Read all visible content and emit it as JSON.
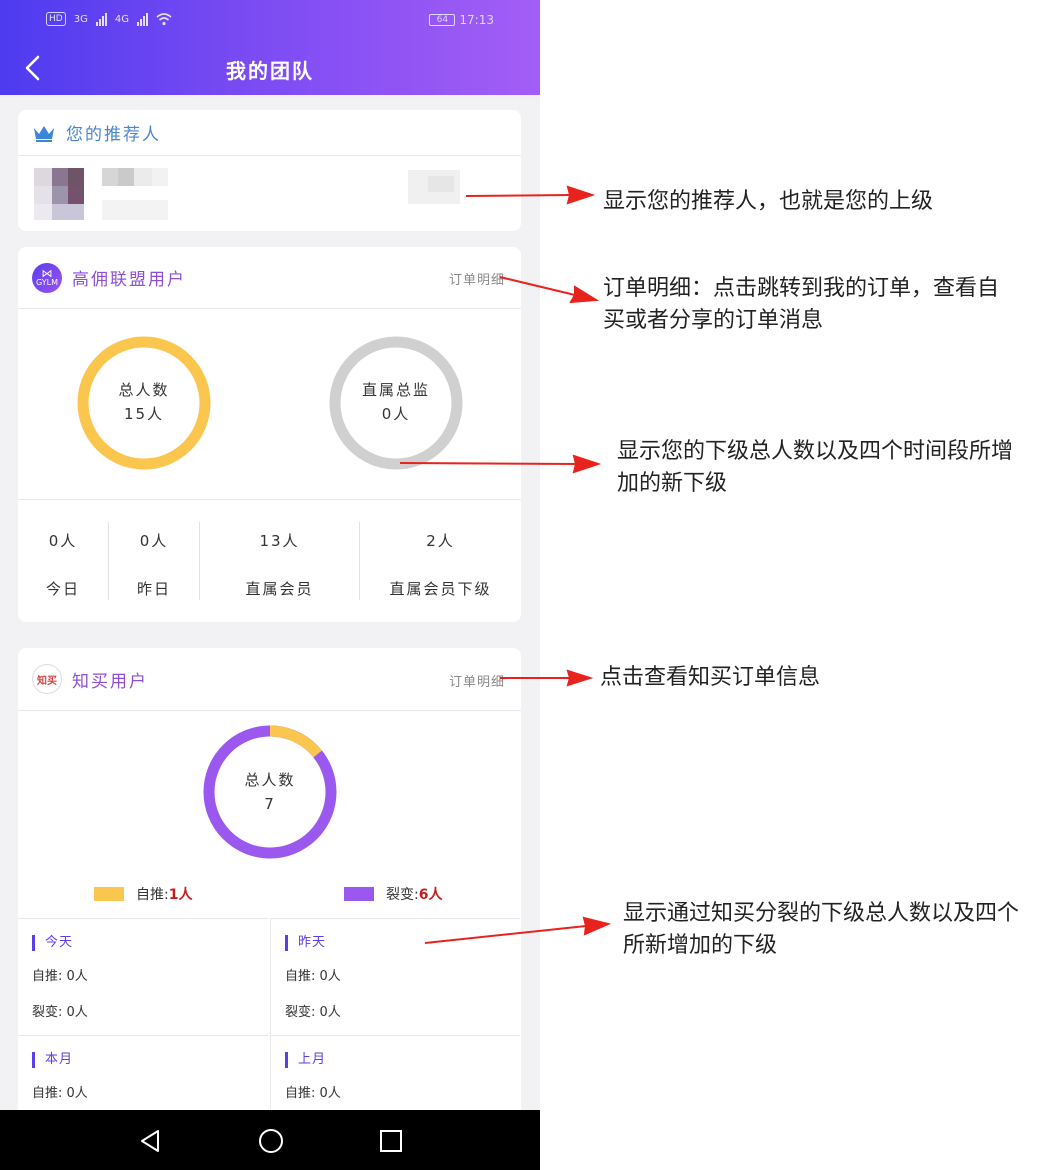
{
  "status_bar": {
    "network_1": "3G",
    "network_2": "4G",
    "battery": "64",
    "time": "17:13",
    "hd": "HD"
  },
  "header": {
    "title": "我的团队"
  },
  "referrer_card": {
    "title": "您的推荐人"
  },
  "gylm_card": {
    "logo_text": "GYLM",
    "title": "高佣联盟用户",
    "detail_link": "订单明细",
    "total_label": "总人数",
    "total_value": "15人",
    "direct_label": "直属总监",
    "direct_value": "0人",
    "stats": [
      {
        "value": "0人",
        "label": "今日"
      },
      {
        "value": "0人",
        "label": "昨日"
      },
      {
        "value": "13人",
        "label": "直属会员"
      },
      {
        "value": "2人",
        "label": "直属会员下级"
      }
    ],
    "colors": {
      "total_ring": "#fbc64e",
      "direct_ring": "#d0d0d0"
    }
  },
  "zhimai_card": {
    "logo_text": "知买",
    "title": "知买用户",
    "detail_link": "订单明细",
    "total_label": "总人数",
    "total_value": "7",
    "legend": [
      {
        "name": "自推:",
        "value": "1人",
        "color": "#fbc64e"
      },
      {
        "name": "裂变:",
        "value": "6人",
        "color": "#9b58ef"
      }
    ],
    "donut": {
      "self": 1,
      "fission": 6
    },
    "periods": [
      {
        "name": "今天",
        "self": "自推: 0人",
        "fission": "裂变: 0人"
      },
      {
        "name": "昨天",
        "self": "自推: 0人",
        "fission": "裂变: 0人"
      },
      {
        "name": "本月",
        "self": "自推: 0人",
        "fission": ""
      },
      {
        "name": "上月",
        "self": "自推: 0人",
        "fission": ""
      }
    ]
  },
  "annotations": {
    "a1": "显示您的推荐人，也就是您的上级",
    "a2_line1": "订单明细：点击跳转到我的订单，查看自",
    "a2_line2": "买或者分享的订单消息",
    "a3_line1": "显示您的下级总人数以及四个时间段所增",
    "a3_line2": "加的新下级",
    "a4": "点击查看知买订单信息",
    "a5_line1": "显示通过知买分裂的下级总人数以及四个",
    "a5_line2": "所新增加的下级"
  },
  "icons": [
    "back-arrow-icon",
    "crown-icon",
    "nav-back-icon",
    "nav-home-icon",
    "nav-recent-icon"
  ]
}
